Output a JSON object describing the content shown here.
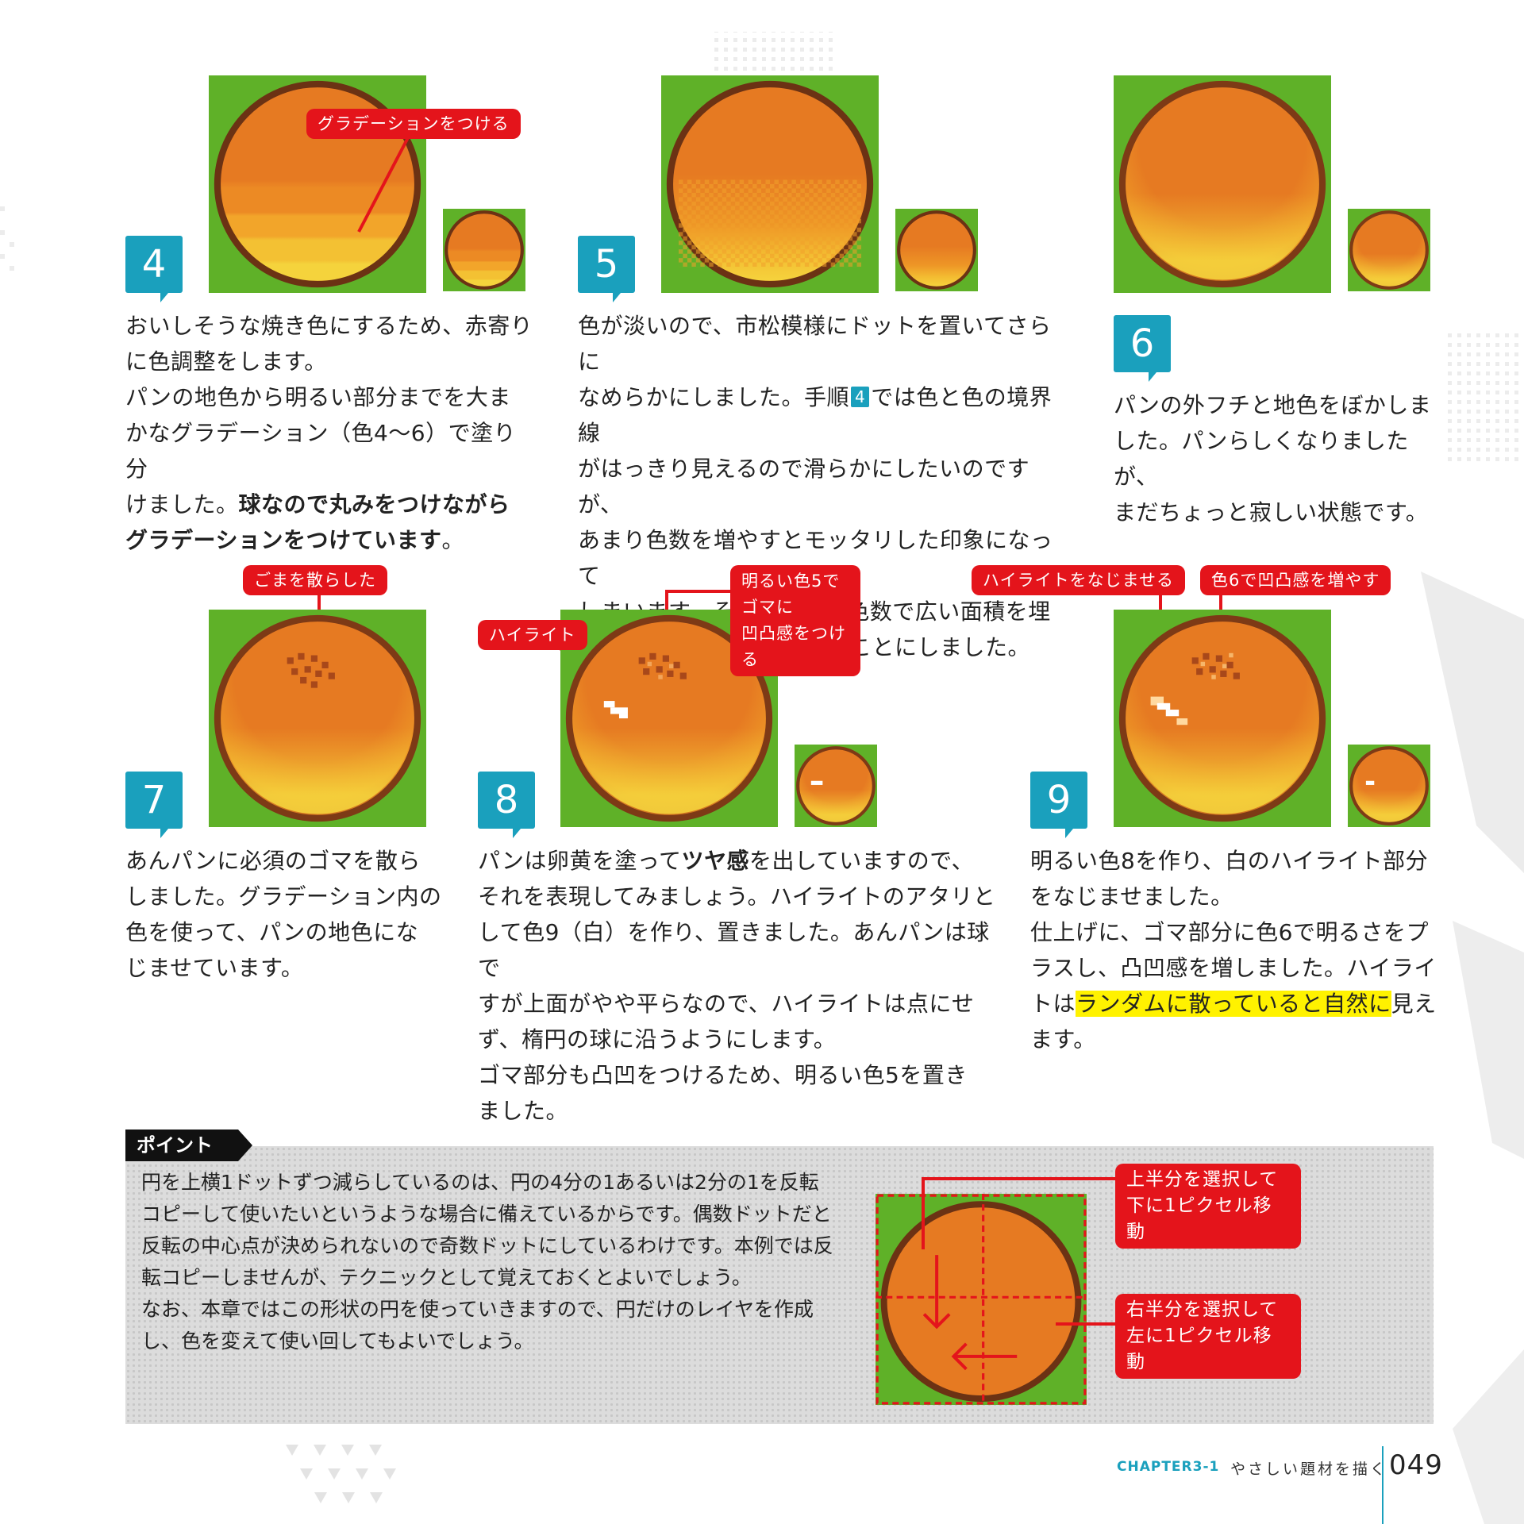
{
  "steps": [
    {
      "number": "4",
      "callouts": [
        "グラデーションをつける"
      ],
      "lines": [
        "おいしそうな焼き色にするため、赤寄り",
        "に色調整をします。",
        "パンの地色から明るい部分までを大ま",
        "かなグラデーション（色4〜6）で塗り分"
      ],
      "line5_normal": "けました。",
      "line5_bold": "球なので丸みをつけながら",
      "line6_bold": "グラデーションをつけています",
      "line6_end": "。"
    },
    {
      "number": "5",
      "line1": "色が淡いので、市松模様にドットを置いてさらに",
      "line2_a": "なめらかにしました。手順",
      "line2_badge": "4",
      "line2_b": "では色と色の境界線",
      "lines": [
        "がはっきり見えるので滑らかにしたいのですが、",
        "あまり色数を増やすとモッタリした印象になって",
        "しまいます。そこで今ある色数で広い面積を埋",
        "めるべく、市松模様を使うことにしました。"
      ]
    },
    {
      "number": "6",
      "lines": [
        "パンの外フチと地色をぼかしま",
        "した。パンらしくなりましたが、",
        "まだちょっと寂しい状態です。"
      ]
    },
    {
      "number": "7",
      "callouts": [
        "ごまを散らした"
      ],
      "lines": [
        "あんパンに必須のゴマを散ら",
        "しました。グラデーション内の",
        "色を使って、パンの地色にな",
        "じませています。"
      ]
    },
    {
      "number": "8",
      "callouts": [
        "明るい色5でゴマに",
        "凹凸感をつける",
        "ハイライト"
      ],
      "line1_a": "パンは卵黄を塗って",
      "line1_bold": "ツヤ感",
      "line1_b": "を出していますので、",
      "lines": [
        "それを表現してみましょう。ハイライトのアタリと",
        "して色9（白）を作り、置きました。あんパンは球で",
        "すが上面がやや平らなので、ハイライトは点にせ",
        "ず、楕円の球に沿うようにします。",
        "ゴマ部分も凸凹をつけるため、明るい色5を置き",
        "ました。"
      ]
    },
    {
      "number": "9",
      "callouts": [
        "ハイライトをなじませる",
        "色6で凹凸感を増やす"
      ],
      "lines": [
        "明るい色8を作り、白のハイライト部分",
        "をなじませました。",
        "仕上げに、ゴマ部分に色6で明るさをプ",
        "ラスし、凸凹感を増しました。ハイライ"
      ],
      "line5_a": "トは",
      "line5_hl": "ランダムに散っていると自然に",
      "line5_b": "見え",
      "line6": "ます。"
    }
  ],
  "point": {
    "label": "ポイント",
    "lines": [
      "円を上横1ドットずつ減らしているのは、円の4分の1あるいは2分の1を反転",
      "コピーして使いたいというような場合に備えているからです。偶数ドットだと",
      "反転の中心点が決められないので奇数ドットにしているわけです。本例では反",
      "転コピーしませんが、テクニックとして覚えておくとよいでしょう。",
      "なお、本章ではこの形状の円を使っていきますので、円だけのレイヤを作成",
      "し、色を変えて使い回してもよいでしょう。"
    ],
    "callouts": [
      "上半分を選択して",
      "下に1ピクセル移動",
      "右半分を選択して",
      "左に1ピクセル移動"
    ]
  },
  "footer": {
    "chapter": "CHAPTER3-1",
    "title": "やさしい題材を描く",
    "page": "049"
  },
  "colors": {
    "accent_blue": "#1aa0bd",
    "callout_red": "#e4141b",
    "grass_green": "#5fb128",
    "bread_orange": "#e67a22",
    "bread_outline": "#6b3214",
    "bread_yellow": "#f2cf3a",
    "highlight_yellow": "#fff200"
  }
}
